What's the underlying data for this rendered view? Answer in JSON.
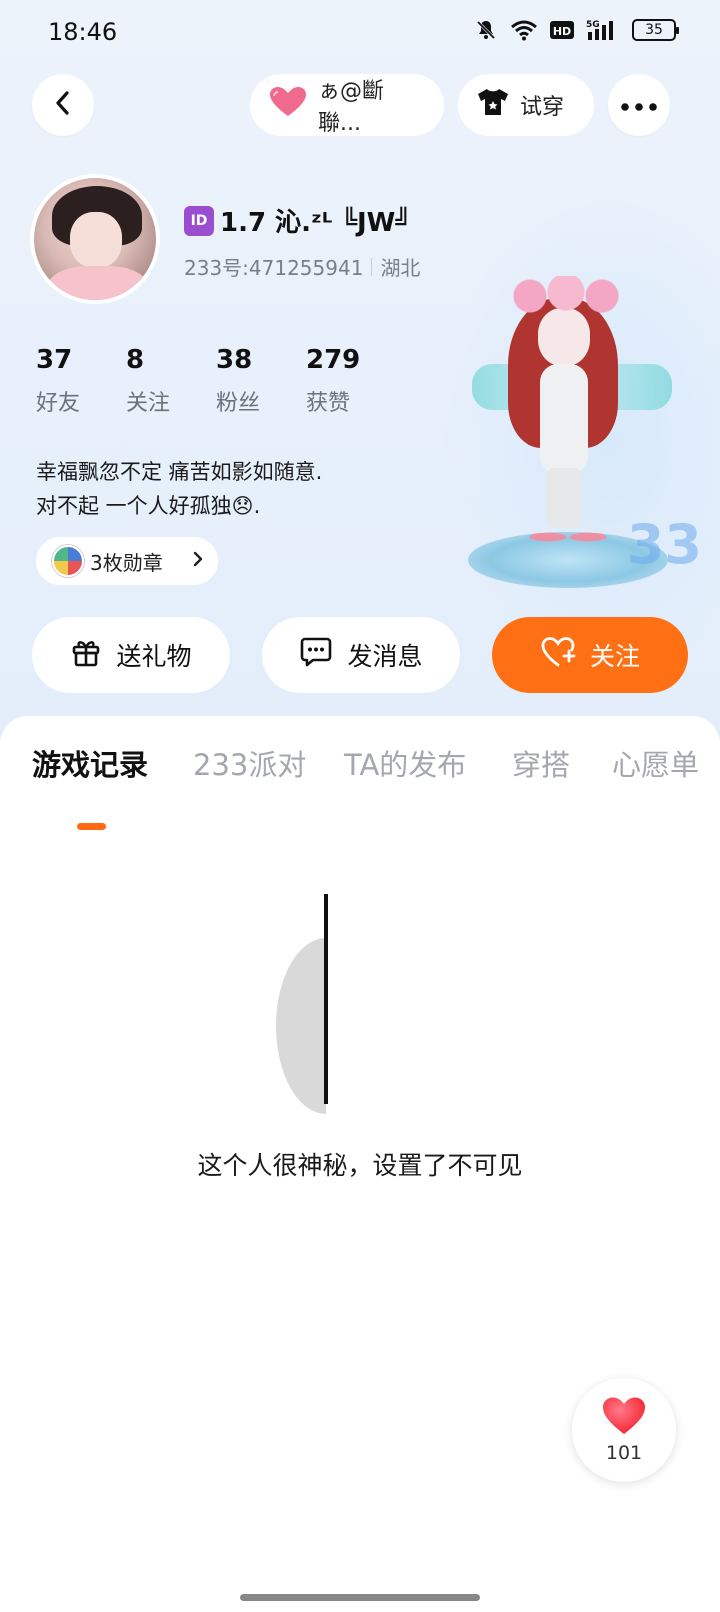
{
  "status_bar": {
    "time": "18:46",
    "battery": "35"
  },
  "header": {
    "partner_label": "ぁ@斷聯...",
    "try_on_label": "试穿"
  },
  "profile": {
    "id_badge": "ID",
    "username": "1.7 沁.ᶻᴸ ╚JW╝",
    "account_id": "233号:471255941",
    "location": "湖北"
  },
  "stats": [
    {
      "value": "37",
      "label": "好友"
    },
    {
      "value": "8",
      "label": "关注"
    },
    {
      "value": "38",
      "label": "粉丝"
    },
    {
      "value": "279",
      "label": "获赞"
    }
  ],
  "bio": {
    "line1": "幸福飘忽不定 痛苦如影如随意.",
    "line2": "对不起  一个人好孤独😞."
  },
  "medals": {
    "label": "3枚勋章"
  },
  "actions": {
    "gift": "送礼物",
    "message": "发消息",
    "follow": "关注"
  },
  "tabs": [
    "游戏记录",
    "233派对",
    "TA的发布",
    "穿搭",
    "心愿单"
  ],
  "empty_state": {
    "text": "这个人很神秘，设置了不可见"
  },
  "like_fab": {
    "count": "101"
  },
  "colors": {
    "accent": "#ff7014",
    "tab_indicator": "#ff6a13",
    "like": "#ff3b4d"
  }
}
